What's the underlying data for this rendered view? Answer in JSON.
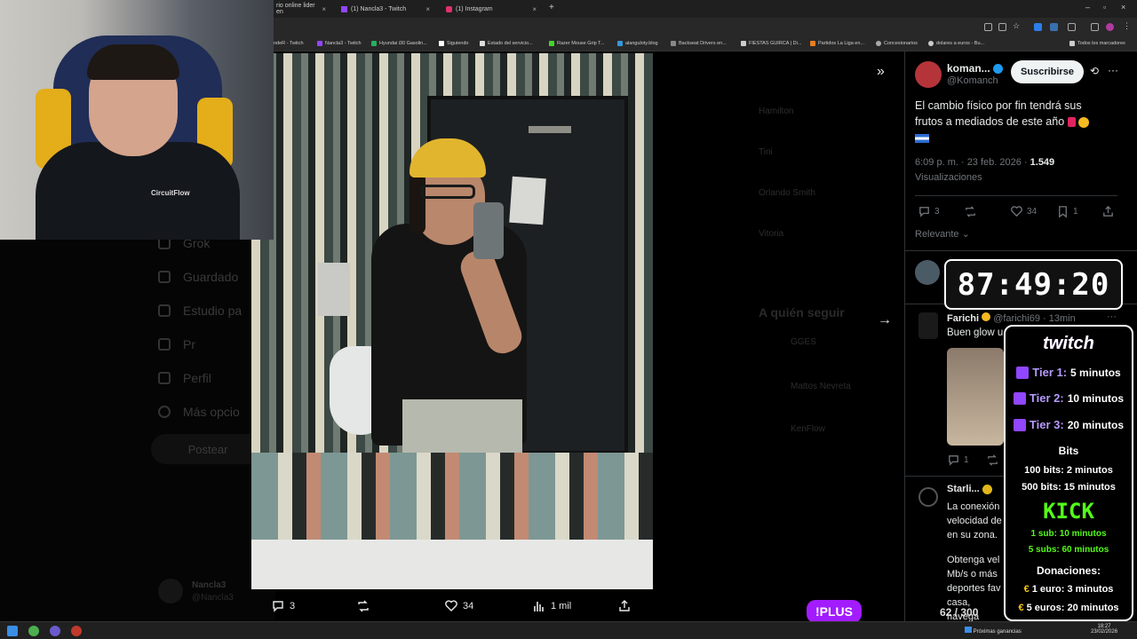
{
  "browser": {
    "tabs": [
      {
        "label": "rio online lider en",
        "color": "#cccccc"
      },
      {
        "label": "(1) Nancla3 - Twitch",
        "color": "#9146ff"
      },
      {
        "label": "(1) Instagram",
        "color": "#e1306c"
      }
    ],
    "new_tab": "+",
    "bookmarks": [
      {
        "label": "ndeR - Twitch",
        "color": "#9146ff"
      },
      {
        "label": "Nancla3 - Twitch",
        "color": "#9146ff"
      },
      {
        "label": "Hyundai i30 Gasolin...",
        "color": "#27ae60"
      },
      {
        "label": "Siguiendo",
        "color": "#ffffff"
      },
      {
        "label": "Estado del servicio...",
        "color": "#dddddd"
      },
      {
        "label": "Razer Mouse Grip T...",
        "color": "#44d62c"
      },
      {
        "label": "alanguloty.blog",
        "color": "#3498db"
      },
      {
        "label": "Backseat Drivers en...",
        "color": "#888888"
      },
      {
        "label": "FIESTAS GUIRCA | Di...",
        "color": "#cccccc"
      },
      {
        "label": "Partidos La Liga en...",
        "color": "#e67e22"
      },
      {
        "label": "Concesionarios",
        "color": "#aaaaaa"
      },
      {
        "label": "dolares a euros - Bu...",
        "color": "#cccccc"
      },
      {
        "label": "Todos los marcadores",
        "color": "#cccccc"
      }
    ]
  },
  "sidebar": {
    "items": [
      "Grok",
      "Guardado",
      "Estudio pa",
      "Pr",
      "Perfil",
      "Más opcio"
    ],
    "post_button": "Postear",
    "account": {
      "name": "Nancla3",
      "handle": "@Nancla3"
    }
  },
  "background_right": {
    "names": [
      "Hamilton",
      "Tini",
      "Orlando Smith",
      "Vitoria"
    ],
    "section_title": "A quién seguir",
    "suggestions": [
      "GGES",
      "Mattos Nevreta",
      "KenFlow"
    ]
  },
  "image_actions": {
    "replies": "3",
    "retweets": "",
    "likes": "34",
    "views": "1 mil"
  },
  "tweet": {
    "author_name": "koman...",
    "author_handle": "@Komanch",
    "subscribe": "Suscribirse",
    "text": "El cambio físico por fin tendrá sus frutos a mediados de este año",
    "timestamp": "6:09 p. m. · 23 feb. 2026 ·",
    "views_count": "1.549",
    "views_label": "Visualizaciones",
    "replies": "3",
    "likes": "34",
    "bookmarks": "1",
    "sort": "Relevante"
  },
  "replies": [
    {
      "name": "Farichi",
      "handle": "@farichi69 · 13min",
      "text": "Buen glow u",
      "replies": "1"
    },
    {
      "name": "Starli...",
      "handle": "",
      "text": "La conexión velocidad de en su zona.",
      "text2": "Obtenga vel Mb/s o más deportes fav casa, navega"
    }
  ],
  "overlay": {
    "timer": "87:49:20",
    "twitch": "twitch",
    "tiers": [
      {
        "label": "Tier 1:",
        "value": "5 minutos"
      },
      {
        "label": "Tier 2:",
        "value": "10 minutos"
      },
      {
        "label": "Tier 3:",
        "value": "20 minutos"
      }
    ],
    "bits_title": "Bits",
    "bits": [
      "100 bits: 2 minutos",
      "500 bits: 15 minutos"
    ],
    "kick": "KICK",
    "kick_rows": [
      "1 sub: 10 minutos",
      "5 subs: 60 minutos"
    ],
    "donations_title": "Donaciones:",
    "donations": [
      "1 euro: 3 minutos",
      "5 euros: 20 minutos"
    ],
    "plus_label": "!PLUS",
    "counter": "62 / 300",
    "shirt_text": "CircuitFlow"
  },
  "taskbar": {
    "news": "Próximas ganancias",
    "time": "18:27",
    "date": "23/02/2026"
  }
}
